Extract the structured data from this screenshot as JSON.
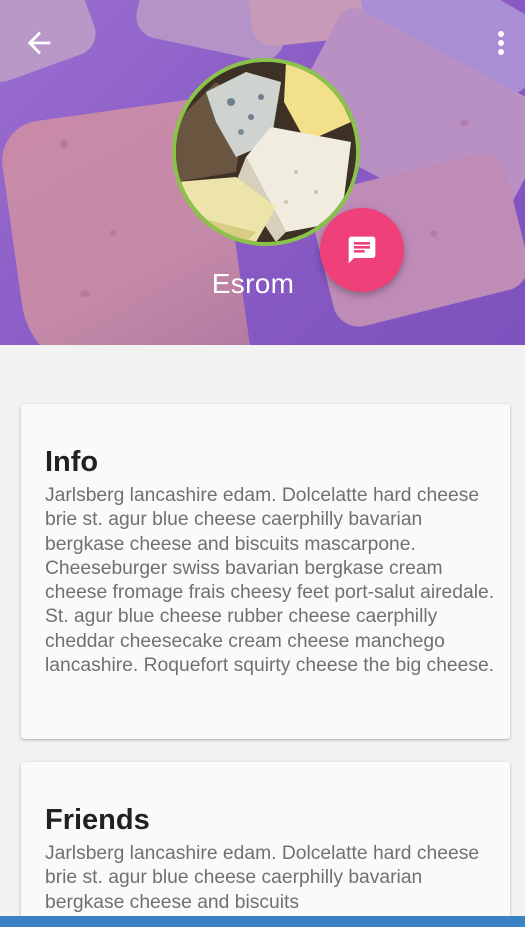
{
  "toolbar": {
    "back_icon": "arrow-back-icon",
    "more_icon": "more-vert-icon"
  },
  "profile": {
    "name": "Esrom",
    "avatar_ring_color": "#8bc34a",
    "header_tint": "#8a5cc6"
  },
  "fab": {
    "icon": "message-icon",
    "color": "#f0407a"
  },
  "cards": [
    {
      "title": "Info",
      "body": "Jarlsberg lancashire edam. Dolcelatte hard cheese brie st. agur blue cheese caerphilly bavarian bergkase cheese and biscuits mascarpone. Cheeseburger swiss bavarian bergkase cream cheese fromage frais cheesy feet port-salut airedale. St. agur blue cheese rubber cheese caerphilly cheddar cheesecake cream cheese manchego lancashire. Roquefort squirty cheese the big cheese."
    },
    {
      "title": "Friends",
      "body": "Jarlsberg lancashire edam. Dolcelatte hard cheese brie st. agur blue cheese caerphilly bavarian bergkase cheese and biscuits"
    }
  ]
}
